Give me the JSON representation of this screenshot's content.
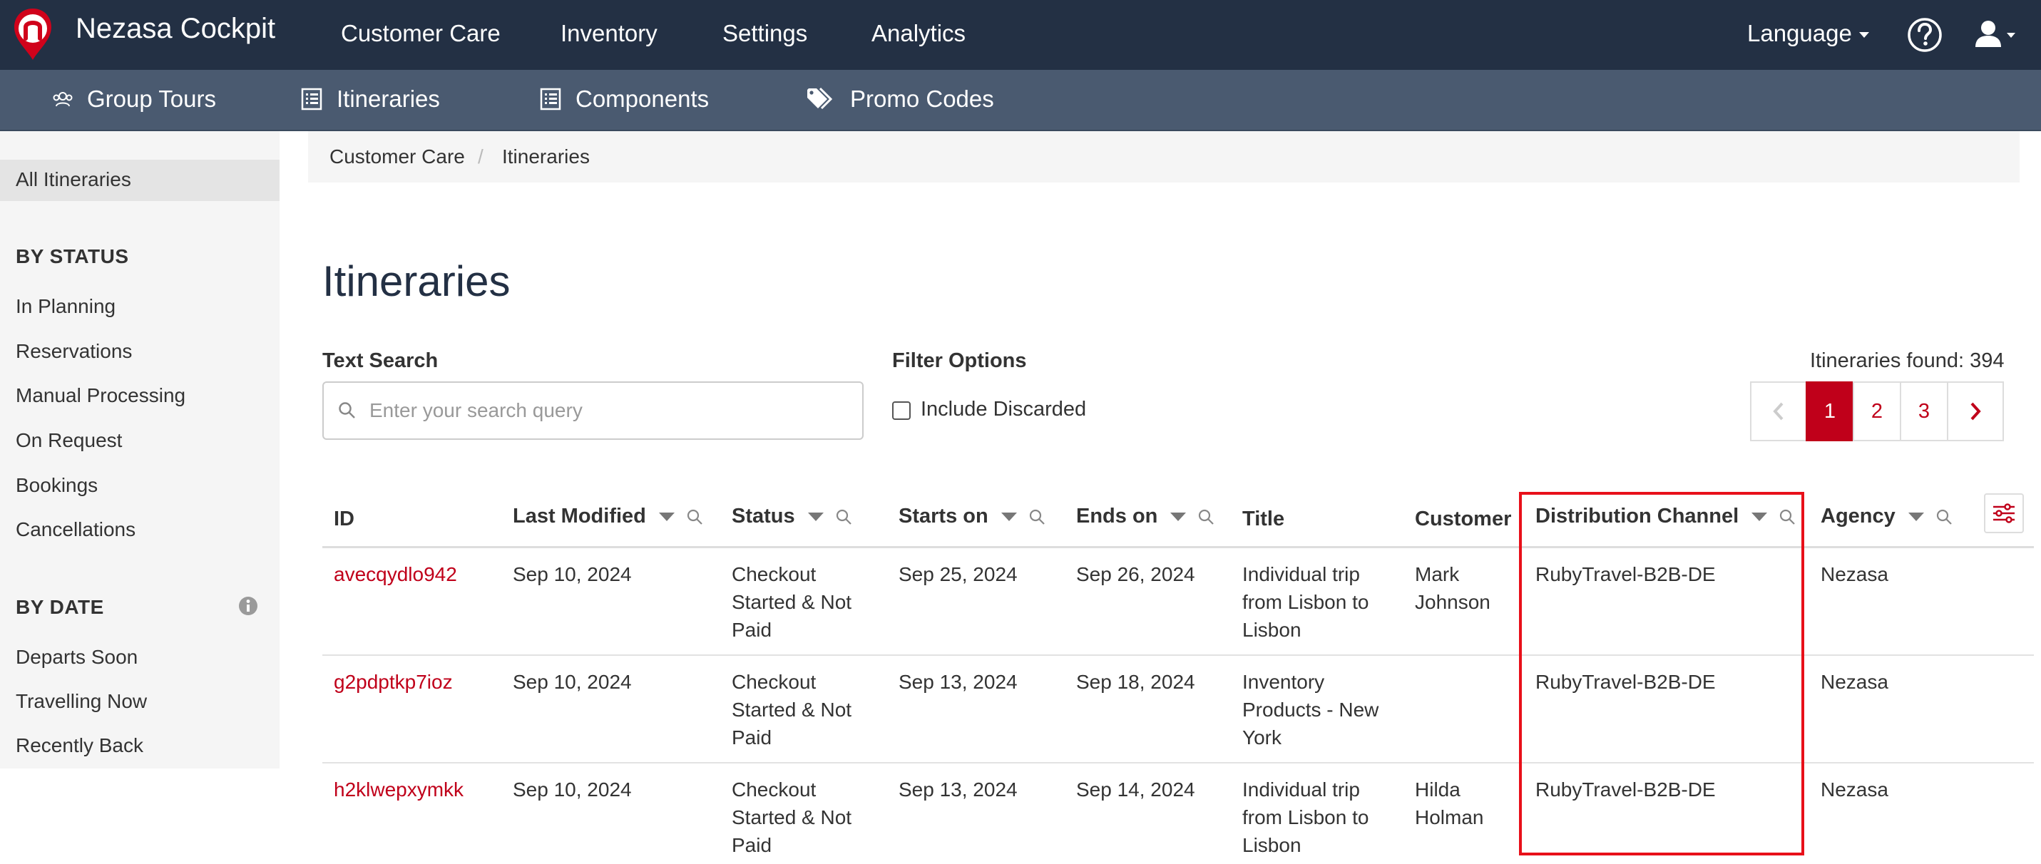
{
  "topnav": {
    "brand": "Nezasa Cockpit",
    "items": [
      "Customer Care",
      "Inventory",
      "Settings",
      "Analytics"
    ],
    "language_label": "Language"
  },
  "subnav": {
    "items": [
      "Group Tours",
      "Itineraries",
      "Components",
      "Promo Codes"
    ]
  },
  "sidebar": {
    "all_label": "All Itineraries",
    "status_heading": "BY STATUS",
    "status_items": [
      "In Planning",
      "Reservations",
      "Manual Processing",
      "On Request",
      "Bookings",
      "Cancellations"
    ],
    "date_heading": "BY DATE",
    "date_items": [
      "Departs Soon",
      "Travelling Now",
      "Recently Back"
    ]
  },
  "breadcrumb": {
    "parent": "Customer Care",
    "separator": "/",
    "current": "Itineraries"
  },
  "main": {
    "title": "Itineraries",
    "search_label": "Text Search",
    "search_placeholder": "Enter your search query",
    "filter_label": "Filter Options",
    "include_discarded_label": "Include Discarded",
    "include_discarded_checked": false,
    "found_text": "Itineraries found: 394"
  },
  "pagination": {
    "pages": [
      "1",
      "2",
      "3"
    ],
    "current_page": "1"
  },
  "table": {
    "headers": {
      "id": "ID",
      "last_modified": "Last Modified",
      "status": "Status",
      "starts_on": "Starts on",
      "ends_on": "Ends on",
      "title": "Title",
      "customer": "Customer",
      "distribution_channel": "Distribution Channel",
      "agency": "Agency"
    },
    "rows": [
      {
        "id": "avecqydlo942",
        "last_modified": "Sep 10, 2024",
        "status": [
          "Checkout",
          "Started & Not",
          "Paid"
        ],
        "starts_on": "Sep 25, 2024",
        "ends_on": "Sep 26, 2024",
        "title": [
          "Individual trip",
          "from Lisbon to",
          "Lisbon"
        ],
        "customer": [
          "Mark",
          "Johnson"
        ],
        "distribution_channel": "RubyTravel-B2B-DE",
        "agency": "Nezasa"
      },
      {
        "id": "g2pdptkp7ioz",
        "last_modified": "Sep 10, 2024",
        "status": [
          "Checkout",
          "Started & Not",
          "Paid"
        ],
        "starts_on": "Sep 13, 2024",
        "ends_on": "Sep 18, 2024",
        "title": [
          "Inventory",
          "Products - New",
          "York"
        ],
        "customer": [
          "",
          ""
        ],
        "distribution_channel": "RubyTravel-B2B-DE",
        "agency": "Nezasa"
      },
      {
        "id": "h2klwepxymkk",
        "last_modified": "Sep 10, 2024",
        "status": [
          "Checkout",
          "Started & Not",
          "Paid"
        ],
        "starts_on": "Sep 13, 2024",
        "ends_on": "Sep 14, 2024",
        "title": [
          "Individual trip",
          "from Lisbon to",
          "Lisbon"
        ],
        "customer": [
          "Hilda",
          "Holman"
        ],
        "distribution_channel": "RubyTravel-B2B-DE",
        "agency": "Nezasa"
      }
    ]
  },
  "colors": {
    "nav_bg": "#233044",
    "subnav_bg": "#4a5a70",
    "accent": "#c0001a",
    "highlight": "#e8101a"
  }
}
